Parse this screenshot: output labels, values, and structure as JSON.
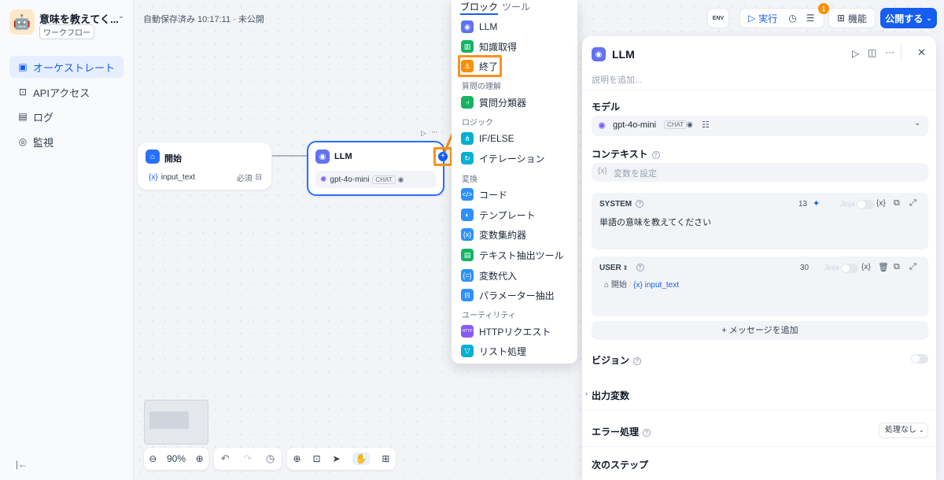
{
  "app": {
    "name": "意味を教えてく...",
    "type": "ワークフロー"
  },
  "sidebar": {
    "items": [
      {
        "label": "オーケストレート",
        "active": true
      },
      {
        "label": "APIアクセス"
      },
      {
        "label": "ログ"
      },
      {
        "label": "監視"
      }
    ]
  },
  "canvas": {
    "autosave": "自動保存済み 10:17:11 · 未公開",
    "zoom": "90%"
  },
  "toolbar": {
    "env": "ENV",
    "run": "実行",
    "checklist_badge": "1",
    "features": "機能",
    "publish": "公開する"
  },
  "nodes": {
    "start": {
      "title": "開始",
      "var": "input_text",
      "required": "必須"
    },
    "llm": {
      "title": "LLM",
      "model": "gpt-4o-mini",
      "tag": "CHAT"
    }
  },
  "block_menu": {
    "tabs": [
      "ブロック",
      "ツール"
    ],
    "items": {
      "llm": "LLM",
      "knowledge": "知識取得",
      "end": "終了",
      "sec_understanding": "質問の理解",
      "classifier": "質問分類器",
      "sec_logic": "ロジック",
      "ifelse": "IF/ELSE",
      "iteration": "イテレーション",
      "sec_transform": "変換",
      "code": "コード",
      "template": "テンプレート",
      "aggregator": "変数集約器",
      "text_extract": "テキスト抽出ツール",
      "assigner": "変数代入",
      "param_extract": "パラメーター抽出",
      "sec_utility": "ユーティリティ",
      "http": "HTTPリクエスト",
      "list": "リスト処理"
    }
  },
  "panel": {
    "title": "LLM",
    "desc_placeholder": "説明を追加...",
    "model_label": "モデル",
    "model": "gpt-4o-mini",
    "model_tag": "CHAT",
    "context_label": "コンテキスト",
    "context_placeholder": "変数を設定",
    "system": {
      "label": "SYSTEM",
      "count": "13",
      "jinja": "Jinja",
      "text": "単語の意味を教えてください"
    },
    "user": {
      "label": "USER",
      "count": "30",
      "jinja": "Jinja",
      "source": "開始",
      "var": "input_text"
    },
    "add_message": "+ メッセージを追加",
    "vision": "ビジョン",
    "output_vars": "出力変数",
    "error_handling": "エラー処理",
    "error_option": "処理なし",
    "next_step": "次のステップ"
  },
  "colors": {
    "accent": "#155eef",
    "highlight": "#f7931e"
  }
}
